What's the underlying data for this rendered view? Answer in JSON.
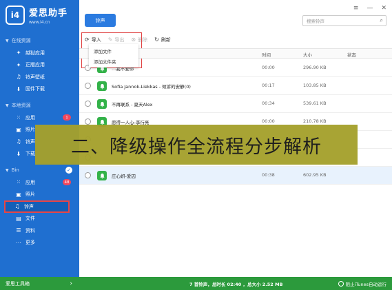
{
  "app": {
    "logo_mark": "i4",
    "name": "爱思助手",
    "url": "www.i4.cn"
  },
  "sidebar": {
    "sections": [
      {
        "title": "在线资源",
        "items": [
          {
            "label": "越狱应用",
            "icon": "app-icon"
          },
          {
            "label": "正版应用",
            "icon": "app-icon"
          },
          {
            "label": "铃声壁纸",
            "icon": "music-icon"
          },
          {
            "label": "固件下载",
            "icon": "download-icon"
          }
        ]
      },
      {
        "title": "本地资源",
        "items": [
          {
            "label": "应用",
            "icon": "grid-icon",
            "badge": "1"
          },
          {
            "label": "照片",
            "icon": "photo-icon"
          },
          {
            "label": "铃声",
            "icon": "music-icon"
          },
          {
            "label": "下载",
            "icon": "download-icon"
          }
        ]
      },
      {
        "title": "Bin",
        "items": [
          {
            "label": "应用",
            "icon": "grid-icon",
            "badge": "48"
          },
          {
            "label": "照片",
            "icon": "photo-icon"
          },
          {
            "label": "铃声",
            "icon": "music-icon",
            "active": true
          },
          {
            "label": "文件",
            "icon": "file-icon"
          },
          {
            "label": "资料",
            "icon": "list-icon"
          },
          {
            "label": "更多",
            "icon": "more-icon"
          }
        ]
      }
    ],
    "footer": "爱思工具箱"
  },
  "header": {
    "tab_label": "铃声",
    "search_placeholder": "搜索铃声",
    "window_controls": [
      "≡",
      "—",
      "✕"
    ]
  },
  "toolbar": {
    "import": "导入",
    "export": "导出",
    "delete": "删除",
    "refresh": "刷新",
    "menu": [
      "添加文件",
      "添加文件夹"
    ]
  },
  "table": {
    "columns": {
      "time": "时间",
      "size": "大小",
      "status": "状态"
    },
    "rows": [
      {
        "title": "...我不爱你",
        "time": "00:00",
        "size": "296.90 KB"
      },
      {
        "title": "Sofia Jannok-Liekkas - 倾诉的安静(0)",
        "time": "00:17",
        "size": "103.85 KB"
      },
      {
        "title": "不再联系 - 夏天Alex",
        "time": "00:34",
        "size": "539.61 KB"
      },
      {
        "title": "愿得一人心-李行亮",
        "time": "00:00",
        "size": "210.78 KB"
      },
      {
        "title": "",
        "time": "",
        "size": ""
      },
      {
        "title": "庄心妍-爱囚",
        "time": "00:38",
        "size": "602.95 KB"
      }
    ]
  },
  "banner": "二、降级操作全流程分步解析",
  "status_bar": {
    "summary": "7 首铃声，总时长 02:40 ，总大小 2.52 MB",
    "itunes": "阻止iTunes自动运行"
  },
  "colors": {
    "sidebar": "#1f6fd0",
    "accent": "#2b7be0",
    "green": "#2c9a3c",
    "highlight": "#e84545"
  }
}
